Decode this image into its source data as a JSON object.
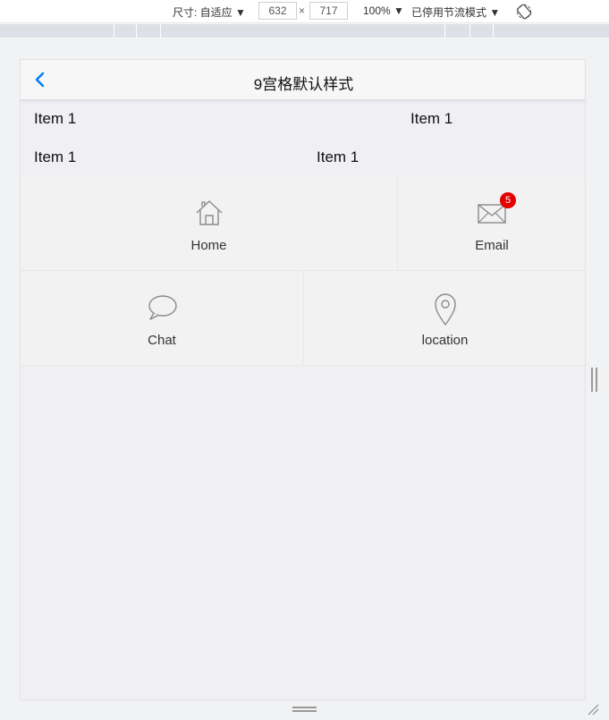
{
  "toolbar": {
    "size_label": "尺寸: 自适应 ▼",
    "width_value": "632",
    "times": "×",
    "height_value": "717",
    "zoom": "100% ▼",
    "throttle": "已停用节流模式 ▼",
    "rotate_icon": "rotate-icon"
  },
  "nav": {
    "title": "9宫格默认样式",
    "back_icon": "chevron-left-icon",
    "accent": "#007aff"
  },
  "text_rows": [
    [
      "Item 1",
      "Item 1"
    ],
    [
      "Item 1",
      "Item 1"
    ]
  ],
  "grid": [
    {
      "label": "Home",
      "icon": "home-icon"
    },
    {
      "label": "Email",
      "icon": "mail-icon",
      "badge": "5"
    },
    {
      "label": "Chat",
      "icon": "chat-icon"
    },
    {
      "label": "location",
      "icon": "location-pin-icon"
    }
  ],
  "colors": {
    "badge": "#e50000",
    "icon_stroke": "#8a8a8a"
  }
}
